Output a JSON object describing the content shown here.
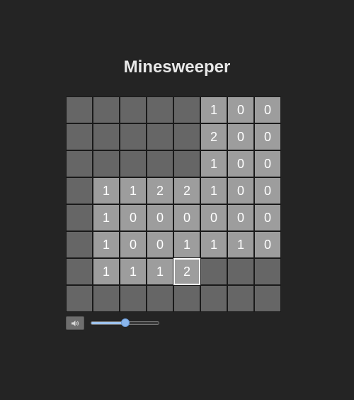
{
  "title": "Minesweeper",
  "board": {
    "rows": 8,
    "cols": 8,
    "selected": [
      6,
      4
    ],
    "cells": [
      [
        "",
        "",
        "",
        "",
        "",
        "1",
        "0",
        "0"
      ],
      [
        "",
        "",
        "",
        "",
        "",
        "2",
        "0",
        "0"
      ],
      [
        "",
        "",
        "",
        "",
        "",
        "1",
        "0",
        "0"
      ],
      [
        "",
        "1",
        "1",
        "2",
        "2",
        "1",
        "0",
        "0"
      ],
      [
        "",
        "1",
        "0",
        "0",
        "0",
        "0",
        "0",
        "0"
      ],
      [
        "",
        "1",
        "0",
        "0",
        "1",
        "1",
        "1",
        "0"
      ],
      [
        "",
        "1",
        "1",
        "1",
        "2",
        "",
        "",
        ""
      ],
      [
        "",
        "",
        "",
        "",
        "",
        "",
        "",
        ""
      ]
    ]
  },
  "controls": {
    "sound_icon": "speaker-icon",
    "volume": 0.5
  },
  "colors": {
    "background": "#242424",
    "hidden_cell": "#666666",
    "open_cell": "#9d9d9d",
    "slider_accent": "#8ab6ec"
  }
}
